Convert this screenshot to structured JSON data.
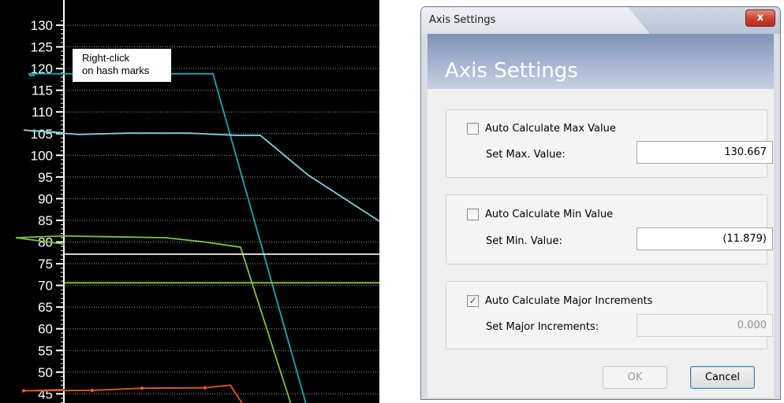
{
  "chart_data": {
    "type": "line",
    "ylim": [
      42,
      131
    ],
    "y_ticks": [
      130,
      125,
      120,
      115,
      110,
      105,
      100,
      95,
      90,
      85,
      80,
      75,
      70,
      65,
      60,
      55,
      50,
      45
    ],
    "grid": true,
    "series": [
      {
        "color": "#1aa7b8",
        "points": [
          [
            0,
            118.8
          ],
          [
            37,
            118.8
          ],
          [
            38,
            118.4
          ],
          [
            43,
            118.4
          ],
          [
            44,
            118.8
          ],
          [
            270,
            118.8
          ],
          [
            389,
            42
          ]
        ]
      },
      {
        "color": "#7fd1de",
        "points": [
          [
            0,
            105.2
          ],
          [
            30,
            105.8
          ],
          [
            100,
            104.8
          ],
          [
            160,
            105.1
          ],
          [
            240,
            105.1
          ],
          [
            300,
            104.6
          ],
          [
            330,
            104.6
          ],
          [
            391,
            95.4
          ],
          [
            481,
            84.8
          ]
        ]
      },
      {
        "color": "#7cc444",
        "points": [
          [
            0,
            79.5
          ],
          [
            20,
            81.0
          ],
          [
            80,
            81.4
          ],
          [
            210,
            81.0
          ],
          [
            260,
            80.0
          ],
          [
            305,
            78.8
          ],
          [
            370,
            42
          ]
        ]
      },
      {
        "color": "#e0e0e0",
        "points": [
          [
            0,
            77.2
          ],
          [
            481,
            77.2
          ]
        ]
      },
      {
        "color": "#8ec63f",
        "points": [
          [
            0,
            70.6
          ],
          [
            481,
            70.6
          ]
        ]
      },
      {
        "color": "#e35a2a",
        "markers": true,
        "points": [
          [
            0,
            46.0
          ],
          [
            30,
            45.7
          ],
          [
            117,
            45.8
          ],
          [
            180,
            46.3
          ],
          [
            260,
            46.4
          ],
          [
            292,
            47.0
          ],
          [
            310,
            42
          ]
        ]
      }
    ],
    "annotation": "Right-click on hash marks"
  },
  "callout": {
    "line1": "Right-click",
    "line2": "on hash marks"
  },
  "dialog": {
    "window_title": "Axis Settings",
    "close_label": "x",
    "header_title": "Axis Settings",
    "groups": [
      {
        "checkbox_label": "Auto Calculate Max Value",
        "checked": false,
        "field_label": "Set Max. Value:",
        "value": "130.667",
        "enabled": true
      },
      {
        "checkbox_label": "Auto Calculate Min Value",
        "checked": false,
        "field_label": "Set Min. Value:",
        "value": "(11.879)",
        "enabled": true
      },
      {
        "checkbox_label": "Auto Calculate Major Increments",
        "checked": true,
        "field_label": "Set Major Increments:",
        "value": "0.000",
        "enabled": false
      }
    ],
    "ok_label": "OK",
    "cancel_label": "Cancel"
  },
  "colors": {
    "chart_background": "#000000",
    "header_band": "#8fa2c4",
    "close_button": "#c6402c"
  }
}
